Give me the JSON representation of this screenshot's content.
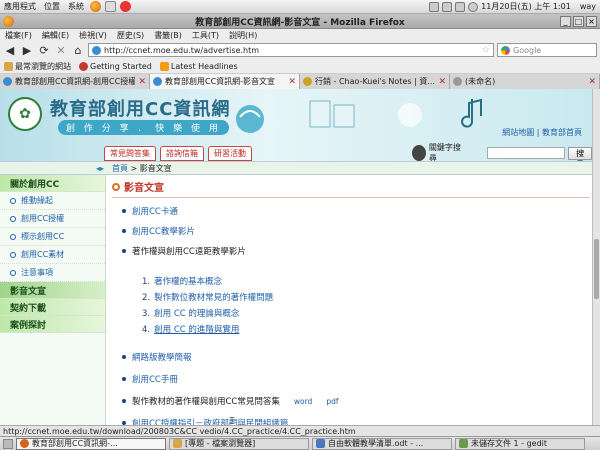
{
  "top_panel": {
    "menus": [
      "應用程式",
      "位置",
      "系統"
    ],
    "clock": "11月20日(五) 上午 1:01",
    "user": "way"
  },
  "window": {
    "title": "教育部創用CC資訊網-影音文宣 - Mozilla Firefox",
    "min": "_",
    "max": "□",
    "close": "×"
  },
  "menubar": [
    "檔案(F)",
    "編輯(E)",
    "檢視(V)",
    "歷史(S)",
    "書籤(B)",
    "工具(T)",
    "說明(H)"
  ],
  "navbar": {
    "url": "http://ccnet.moe.edu.tw/advertise.htm",
    "search_placeholder": "Google"
  },
  "bookmarks": [
    "最常瀏覽的網站",
    "Getting Started",
    "Latest Headlines"
  ],
  "tabs": [
    {
      "label": "教育部創用CC資訊網-創用CC授權",
      "active": false
    },
    {
      "label": "教育部創用CC資訊網-影音文宣",
      "active": true
    },
    {
      "label": "行銷 - Chao-Kuei's Notes | 資...",
      "active": false
    },
    {
      "label": "(未命名)",
      "active": false
    }
  ],
  "site": {
    "title": "教育部創用CC資訊網",
    "slogan": "創 作 分 享 ． 快 樂 使 用",
    "toplinks": "網站地圖 | 教育部首頁",
    "navtabs": [
      "常見問答集",
      "諮詢信箱",
      "研習活動"
    ],
    "keyword_label": "關鍵字搜尋",
    "search_button": "搜尋"
  },
  "breadcrumb": {
    "home": "首頁",
    "sep": " > ",
    "current": "影音文宣"
  },
  "sidebar": [
    {
      "label": "關於創用CC",
      "type": "head"
    },
    {
      "label": "推動緣起",
      "type": "item"
    },
    {
      "label": "創用CC授權",
      "type": "item"
    },
    {
      "label": "標示創用CC",
      "type": "item"
    },
    {
      "label": "創用CC素材",
      "type": "item"
    },
    {
      "label": "注意事項",
      "type": "item"
    },
    {
      "label": "影音文宣",
      "type": "head"
    },
    {
      "label": "契約下載",
      "type": "head"
    },
    {
      "label": "案例探討",
      "type": "head"
    }
  ],
  "main": {
    "section_title": "影音文宣",
    "items": [
      {
        "label": "創用CC卡通",
        "link": true
      },
      {
        "label": "創用CC教學影片",
        "link": true
      },
      {
        "label": "著作權與創用CC遠距教學影片",
        "link": false
      },
      {
        "label": "網路版教學簡報",
        "link": true
      },
      {
        "label": "創用CC手冊",
        "link": true
      },
      {
        "label": "製作教材的著作權與創用CC常見問答集",
        "link": false,
        "formats": [
          "word",
          "pdf"
        ]
      },
      {
        "label": "創用CC授權指引－政府部門與民間組織篇",
        "link": true
      }
    ],
    "subitems": [
      {
        "num": "1.",
        "label": "著作權的基本概念"
      },
      {
        "num": "2.",
        "label": "製作數位教材常見的著作權問題"
      },
      {
        "num": "3.",
        "label": "創用 CC 的理論與概念"
      },
      {
        "num": "4.",
        "label": "創用 CC 的進階與實用"
      }
    ]
  },
  "statusbar": "http://ccnet.moe.edu.tw/download/200803C&CC vedio/4.CC_practice/4.CC_practice.htm",
  "taskbar": [
    {
      "label": "教育部創用CC資訊網-...",
      "active": true
    },
    {
      "label": "[專題 - 檔案瀏覽器]",
      "active": false
    },
    {
      "label": "自由軟體教學清單.odt - ...",
      "active": false
    },
    {
      "label": "未儲存文件 1 - gedit",
      "active": false
    }
  ]
}
